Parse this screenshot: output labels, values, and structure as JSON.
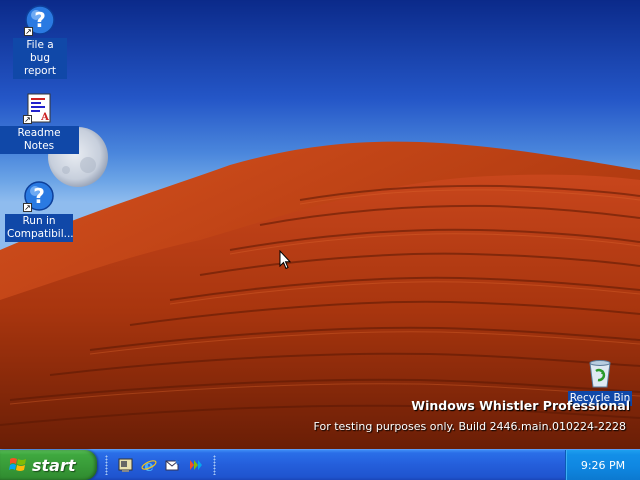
{
  "desktop": {
    "icons": [
      {
        "label": "File a bug report",
        "icon": "help-icon"
      },
      {
        "label": "Readme Notes",
        "icon": "document-icon"
      },
      {
        "label": "Run in Compatibil...",
        "icon": "help-icon"
      },
      {
        "label": "Recycle Bin",
        "icon": "recycle-bin-icon"
      }
    ],
    "watermark": {
      "title": "Windows Whistler Professional",
      "build": "For testing purposes only. Build 2446.main.010224-2228"
    }
  },
  "taskbar": {
    "start_label": "start",
    "quick_launch": [
      "show-desktop-icon",
      "internet-explorer-icon",
      "outlook-express-icon",
      "windows-media-player-icon"
    ],
    "clock": "9:26 PM"
  },
  "colors": {
    "taskbar": "#245edb",
    "start_button": "#379937",
    "tray": "#0f86e0",
    "icon_label_bg": "#1048a8"
  }
}
